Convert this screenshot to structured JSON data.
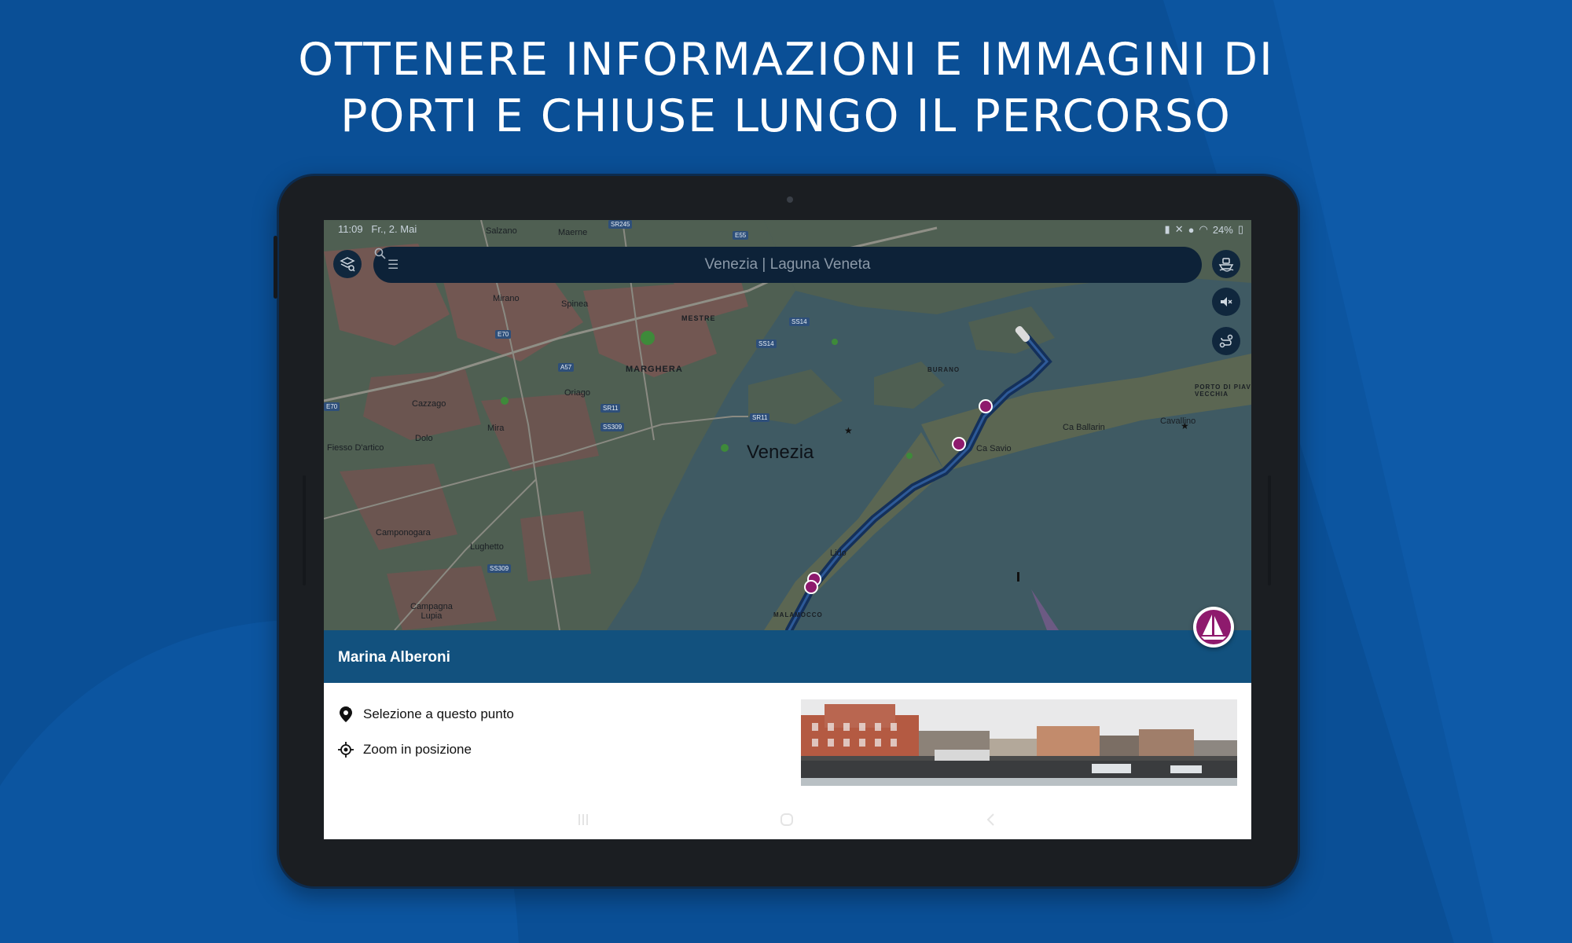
{
  "headline": {
    "line1": "OTTENERE INFORMAZIONI E IMMAGINI DI",
    "line2": "PORTI E CHIUSE LUNGO IL PERCORSO"
  },
  "status_bar": {
    "time": "11:09",
    "date": "Fr., 2. Mai",
    "battery": "24%"
  },
  "search": {
    "text": "Venezia | Laguna Veneta"
  },
  "map_labels": {
    "venezia": "Venezia",
    "salzano": "Salzano",
    "maerne": "Maerne",
    "mirano": "Mirano",
    "spinea": "Spinea",
    "mestre": "MESTRE",
    "marghera": "MARGHERA",
    "oriago": "Oriago",
    "cazzago": "Cazzago",
    "mira": "Mira",
    "dolo": "Dolo",
    "fiesso": "Fiesso D'artico",
    "camponogara": "Camponogara",
    "lughetto": "Lughetto",
    "campagna_lupia": "Campagna\nLupia",
    "burano": "BURANO",
    "porto_piave": "PORTO DI PIAVE\nVECCHIA",
    "cavallino": "Cavallino",
    "ca_ballarin": "Ca Ballarin",
    "ca_savio": "Ca Savio",
    "lido": "Lido",
    "malamocco": "MALAMOCCO"
  },
  "road_badges": {
    "sr245": "SR245",
    "e55": "E55",
    "ss14": "SS14",
    "ss14b": "SS14",
    "a57": "A57",
    "e70": "E70",
    "e70b": "E70",
    "sr11": "SR11",
    "ss309": "SS309",
    "sr11b": "SR11",
    "ss309b": "SS309"
  },
  "info_panel": {
    "title": "Marina Alberoni",
    "action_1": "Selezione a questo punto",
    "action_2": "Zoom in posizione"
  },
  "colors": {
    "background": "#0a4f96",
    "panel_header": "#12517e",
    "route": "#1a3a6b",
    "marina_pin": "#8e1a6d"
  },
  "icons": [
    "layers-search-icon",
    "menu-icon",
    "search-icon",
    "ferry-icon",
    "mute-icon",
    "route-icon",
    "marina-icon",
    "pin-select-icon",
    "crosshair-icon"
  ]
}
